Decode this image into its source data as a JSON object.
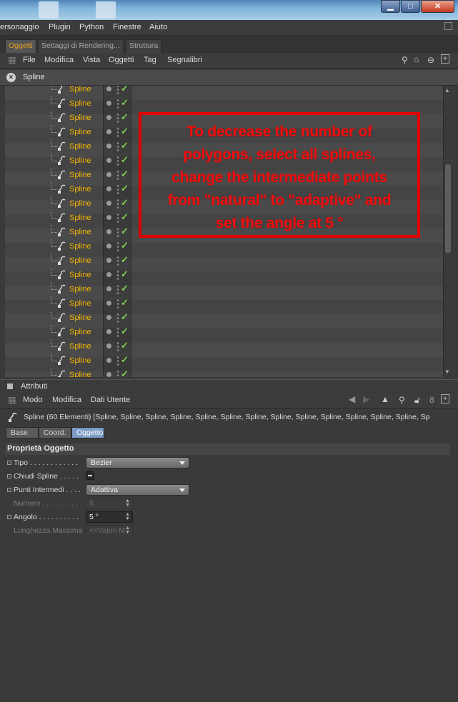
{
  "menubar": {
    "items": [
      "ersonaggio",
      "Plugin",
      "Python",
      "Finestre",
      "Aiuto"
    ]
  },
  "object_manager": {
    "tabs": [
      {
        "label": "Oggetti",
        "active": true
      },
      {
        "label": "Settaggi di Rendering...",
        "active": false
      },
      {
        "label": "Struttura",
        "active": false
      }
    ],
    "toolbar": [
      "File",
      "Modifica",
      "Vista",
      "Oggetti",
      "Tag",
      "Segnalibri"
    ],
    "search": {
      "value": "Spline"
    },
    "object_name": "Spline",
    "visible_rows": 21,
    "colors": {
      "object_name": "#f0b400",
      "check": "#7ccf4d"
    }
  },
  "annotation": {
    "lines": [
      "To decrease the number of",
      "polygons, select all splines,",
      "change the intermediate points",
      "from \"natural\" to \"adaptive\" and",
      "set the angle at 5 °"
    ],
    "color": "#e00000"
  },
  "attributes": {
    "header": "Attributi",
    "toolbar": [
      "Modo",
      "Modifica",
      "Dati Utente"
    ],
    "object_line": "Spline (60 Elementi) [Spline, Spline, Spline, Spline, Spline, Spline, Spline, Spline, Spline, Spline, Spline, Spline, Spline, Sp",
    "subtabs": [
      {
        "label": "Base",
        "active": false
      },
      {
        "label": "Coord.",
        "active": false
      },
      {
        "label": "Oggetto",
        "active": true
      }
    ],
    "section_title": "Proprietà Oggetto",
    "properties": [
      {
        "label": "Tipo . . . . . . . . . . . .",
        "kind": "dropdown",
        "value": "Bezier",
        "enabled": true
      },
      {
        "label": "Chiudi Spline . . . . .",
        "kind": "checkbox",
        "value": "",
        "enabled": true
      },
      {
        "label": "Punti Intermedi . . . .",
        "kind": "dropdown",
        "value": "Adattiva",
        "enabled": true
      },
      {
        "label": "Numero . . . . . . . . .",
        "kind": "number",
        "value": "8",
        "enabled": false
      },
      {
        "label": "Angolo . . . . . . . . . .",
        "kind": "number",
        "value": "5 °",
        "enabled": true
      },
      {
        "label": "Lunghezza Massima",
        "kind": "number",
        "value": "<<Valori M",
        "enabled": false
      }
    ]
  }
}
